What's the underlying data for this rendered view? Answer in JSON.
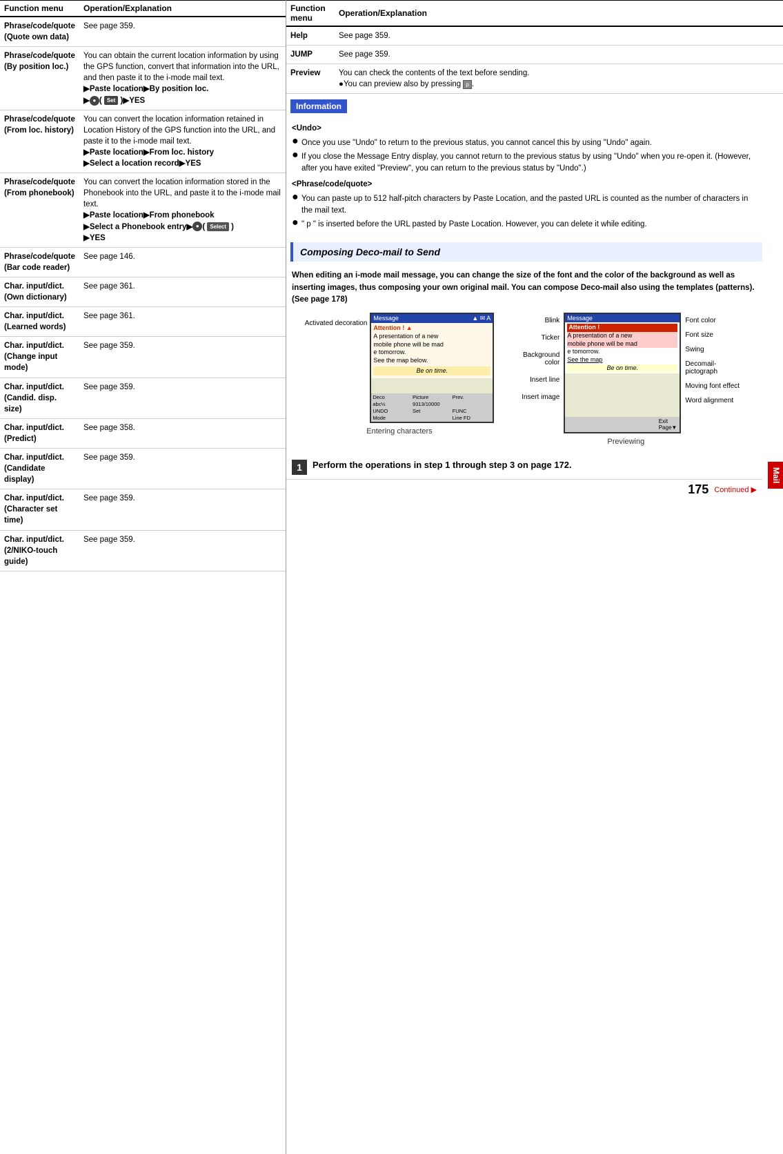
{
  "left_table": {
    "headers": [
      "Function menu",
      "Operation/Explanation"
    ],
    "rows": [
      {
        "func": "Phrase/code/quote (Quote own data)",
        "op": "See page 359."
      },
      {
        "func": "Phrase/code/quote (By position loc.)",
        "op": "You can obtain the current location information by using the GPS function, convert that information into the URL, and then paste it to the i-mode mail text.",
        "extra": "▶Paste location▶By position loc.▶●( Set )▶YES"
      },
      {
        "func": "Phrase/code/quote (From loc. history)",
        "op": "You can convert the location information retained in Location History of the GPS function into the URL, and paste it to the i-mode mail text.",
        "extra": "▶Paste location▶From loc. history▶Select a location record▶YES"
      },
      {
        "func": "Phrase/code/quote (From phonebook)",
        "op": "You can convert the location information stored in the Phonebook into the URL, and paste it to the i-mode mail text.",
        "extra": "▶Paste location▶From phonebook▶Select a Phonebook entry▶●( Select )▶YES"
      },
      {
        "func": "Phrase/code/quote (Bar code reader)",
        "op": "See page 146."
      },
      {
        "func": "Char. input/dict. (Own dictionary)",
        "op": "See page 361."
      },
      {
        "func": "Char. input/dict. (Learned words)",
        "op": "See page 361."
      },
      {
        "func": "Char. input/dict. (Change input mode)",
        "op": "See page 359."
      },
      {
        "func": "Char. input/dict. (Candid. disp. size)",
        "op": "See page 359."
      },
      {
        "func": "Char. input/dict. (Predict)",
        "op": "See page 358."
      },
      {
        "func": "Char. input/dict. (Candidate display)",
        "op": "See page 359."
      },
      {
        "func": "Char. input/dict. (Character set time)",
        "op": "See page 359."
      },
      {
        "func": "Char. input/dict. (2/NIKO-touch guide)",
        "op": "See page 359."
      }
    ]
  },
  "right_table": {
    "headers": [
      "Function menu",
      "Operation/Explanation"
    ],
    "rows": [
      {
        "func": "Help",
        "op": "See page 359."
      },
      {
        "func": "JUMP",
        "op": "See page 359."
      },
      {
        "func": "Preview",
        "op": "You can check the contents of the text before sending.",
        "bullet": "You can preview also by pressing p."
      }
    ]
  },
  "info_box": {
    "label": "Information"
  },
  "info_section": {
    "undo_heading": "<Undo>",
    "undo_bullets": [
      "Once you use \"Undo\" to return to the previous status, you cannot cancel this by using \"Undo\" again.",
      "If you close the Message Entry display, you cannot return to the previous status by using \"Undo\" when you re-open it. (However, after you have exited \"Preview\", you can return to the previous status by \"Undo\".)"
    ],
    "phrase_heading": "<Phrase/code/quote>",
    "phrase_bullets": [
      "You can paste up to 512 half-pitch characters by Paste Location, and the pasted URL is counted as the number of characters in the mail text.",
      "\" p \" is inserted before the URL pasted by Paste Location. However, you can delete it while editing."
    ]
  },
  "deco_section": {
    "title": "Composing Deco-mail to Send",
    "description": "When editing an i-mode mail message, you can change the size of the font and the color of the background as well as inserting images, thus composing your own original mail. You can compose Deco-mail also using the templates (patterns). (See page 178)"
  },
  "screenshots": {
    "first": {
      "label": "Entering characters",
      "top_bar": "Message",
      "content_lines": [
        "Attention ! ▲",
        "A presentation of a new",
        "mobile phone will be mad",
        "e tomorrow.",
        "See the map below.",
        "Be on time."
      ],
      "toolbar_items": [
        "Deco",
        "Picture",
        "Prev.",
        "abc½",
        "9313/10000",
        "",
        "UNDO",
        "Set",
        "FUNC",
        "Mode",
        "",
        "Line FD"
      ]
    },
    "second": {
      "label": "Previewing",
      "top_bar": "Message",
      "content_lines": [
        "Attention !",
        "A presentation of a new",
        "mobile phone will be mad",
        "e tomorrow.",
        "See the map",
        "Be on time."
      ]
    },
    "left_labels": [
      "Activated decoration"
    ],
    "right_labels_first": [],
    "blink_label": "Blink",
    "ticker_label": "Ticker",
    "bg_color_label": "Background color",
    "insert_line_label": "Insert line",
    "insert_image_label": "Insert image",
    "font_color_label": "Font color",
    "font_size_label": "Font size",
    "swing_label": "Swing",
    "decomail_label": "Decomail-pictograph",
    "moving_font_label": "Moving font effect",
    "word_align_label": "Word alignment"
  },
  "step": {
    "number": "1",
    "text": "Perform the operations in step 1 through step 3 on page 172."
  },
  "page": {
    "number": "175",
    "continued": "Continued ▶"
  },
  "mail_tab": {
    "label": "Mail"
  }
}
